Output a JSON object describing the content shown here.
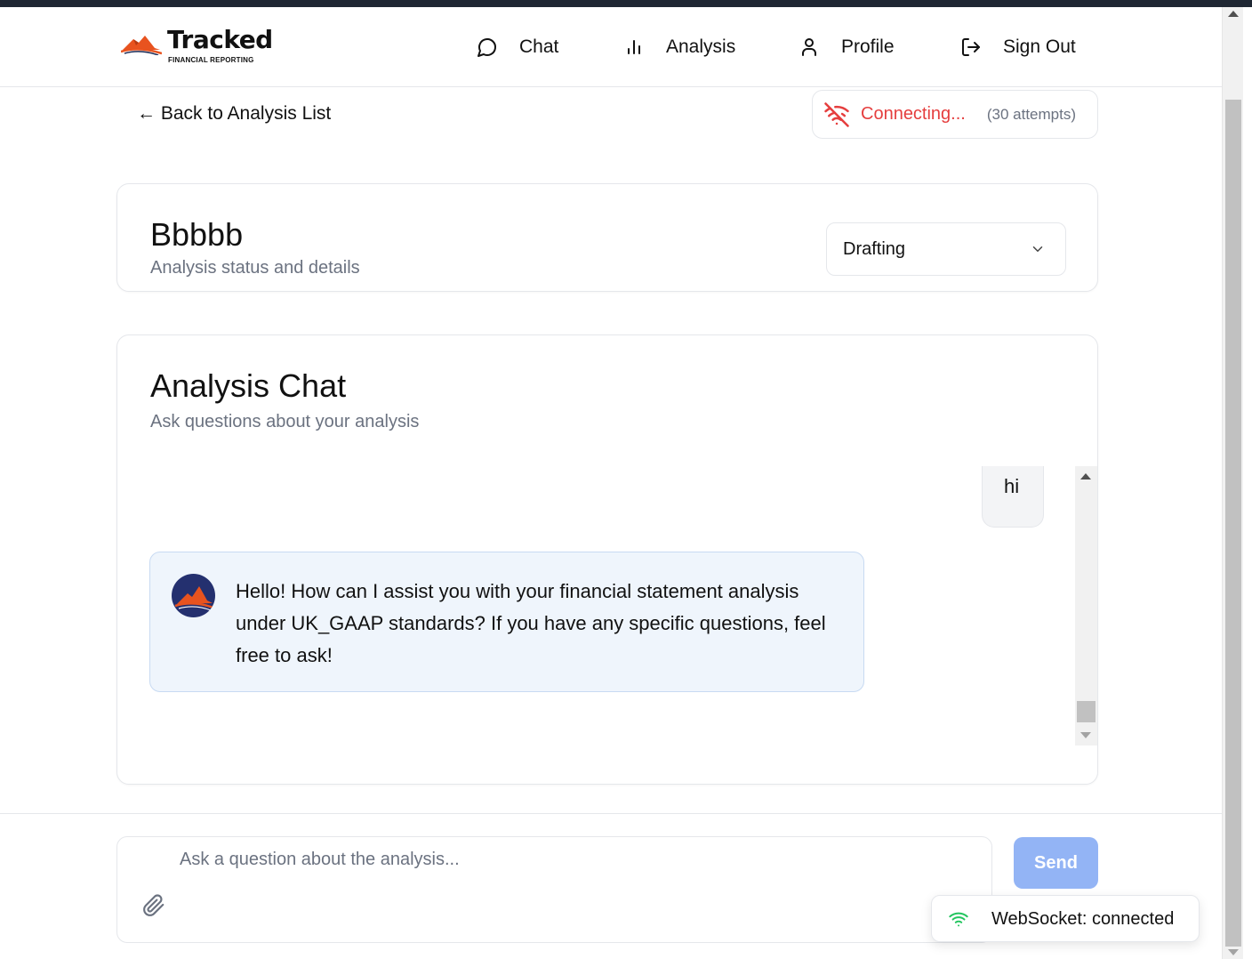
{
  "header": {
    "brand_name": "Tracked",
    "brand_tagline": "FINANCIAL REPORTING",
    "nav": [
      {
        "label": "Chat",
        "icon": "chat-bubble-icon"
      },
      {
        "label": "Analysis",
        "icon": "bar-chart-icon"
      },
      {
        "label": "Profile",
        "icon": "user-icon"
      },
      {
        "label": "Sign Out",
        "icon": "sign-out-icon"
      }
    ]
  },
  "back_link": "← Back to Analysis List",
  "connection": {
    "status": "Connecting...",
    "attempts": "(30 attempts)",
    "icon": "wifi-off-icon",
    "color": "#e53e3e"
  },
  "analysis": {
    "title": "Bbbbb",
    "subtitle": "Analysis status and details",
    "status_value": "Drafting"
  },
  "chat": {
    "title": "Analysis Chat",
    "subtitle": "Ask questions about your analysis",
    "messages": [
      {
        "role": "user",
        "text": "hi"
      },
      {
        "role": "assistant",
        "text": "Hello! How can I assist you with your financial statement analysis under UK_GAAP standards? If you have any specific questions, feel free to ask!"
      }
    ]
  },
  "composer": {
    "placeholder": "Ask a question about the analysis...",
    "value": "",
    "send_label": "Send",
    "send_color": "#93b4f5"
  },
  "websocket_toast": {
    "text": "WebSocket: connected",
    "icon": "wifi-icon",
    "color": "#22c55e"
  },
  "colors": {
    "brand_orange": "#e8531f",
    "avatar_navy": "#24306f",
    "assistant_bubble": "#eff5fc"
  }
}
